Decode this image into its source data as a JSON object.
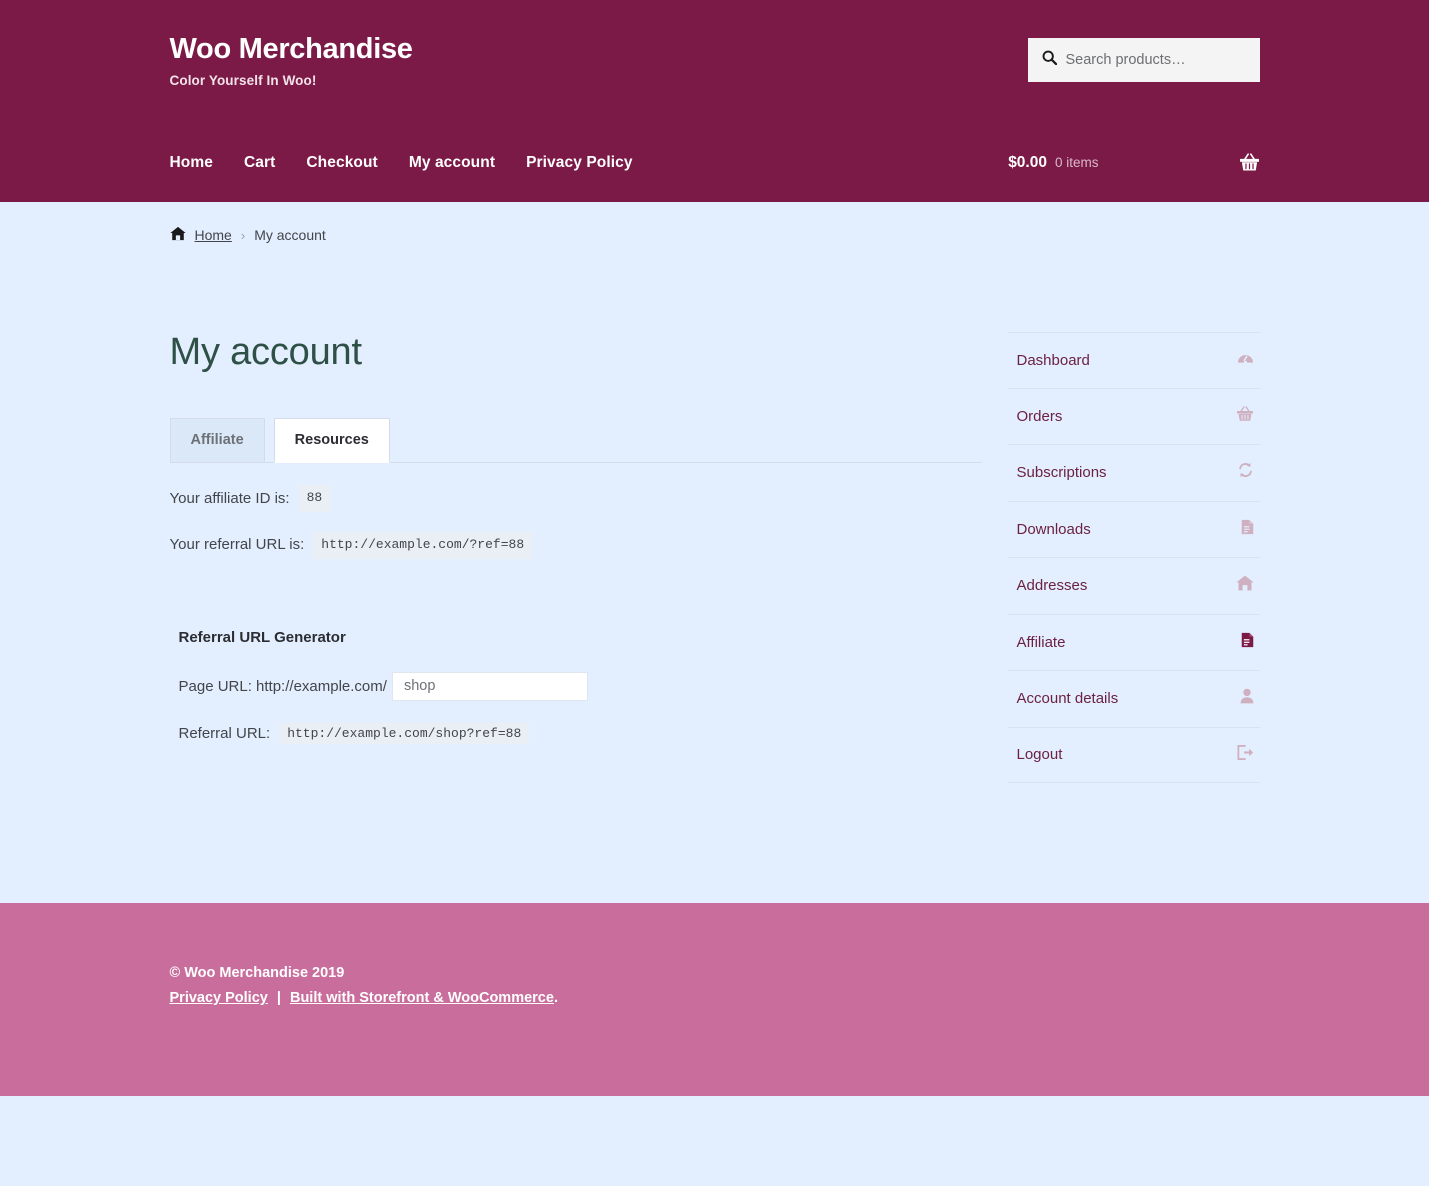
{
  "theme": {
    "header_bg": "#7b1a46",
    "body_bg": "#e3efff",
    "footer_bg": "#c96e9c",
    "heading_color": "#2f5046",
    "link_color": "#6c2142",
    "active_icon_color": "#7b1a46",
    "muted_icon_color": "#c9a8ba"
  },
  "header": {
    "site_title": "Woo Merchandise",
    "site_description": "Color Yourself In Woo!",
    "search": {
      "icon": "search-icon",
      "placeholder": "Search products…",
      "value": ""
    },
    "nav": [
      {
        "label": "Home",
        "name": "nav-home"
      },
      {
        "label": "Cart",
        "name": "nav-cart"
      },
      {
        "label": "Checkout",
        "name": "nav-checkout"
      },
      {
        "label": "My account",
        "name": "nav-my-account"
      },
      {
        "label": "Privacy Policy",
        "name": "nav-privacy-policy"
      }
    ],
    "cart": {
      "amount": "$0.00",
      "count": "0 items",
      "icon": "basket-icon"
    }
  },
  "breadcrumb": {
    "home_icon": "home-icon",
    "home_label": "Home",
    "separator": "›",
    "current": "My account"
  },
  "main": {
    "page_title": "My account",
    "tabs": [
      {
        "label": "Affiliate",
        "active": false
      },
      {
        "label": "Resources",
        "active": true
      }
    ],
    "affiliate_id": {
      "label": "Your affiliate ID is:",
      "value": "88"
    },
    "referral_url": {
      "label": "Your referral URL is:",
      "value": "http://example.com/?ref=88"
    },
    "generator": {
      "heading": "Referral URL Generator",
      "page_url_label": "Page URL: http://example.com/",
      "page_url_value": "shop",
      "page_url_placeholder": "",
      "referral_url_label": "Referral URL:",
      "referral_url_value": "http://example.com/shop?ref=88"
    }
  },
  "sidebar": {
    "items": [
      {
        "label": "Dashboard",
        "icon": "dashboard-icon",
        "active": false
      },
      {
        "label": "Orders",
        "icon": "basket-icon",
        "active": false
      },
      {
        "label": "Subscriptions",
        "icon": "refresh-icon",
        "active": false
      },
      {
        "label": "Downloads",
        "icon": "document-download-icon",
        "active": false
      },
      {
        "label": "Addresses",
        "icon": "home-icon",
        "active": false
      },
      {
        "label": "Affiliate",
        "icon": "file-text-icon",
        "active": true
      },
      {
        "label": "Account details",
        "icon": "user-icon",
        "active": false
      },
      {
        "label": "Logout",
        "icon": "logout-icon",
        "active": false
      }
    ]
  },
  "footer": {
    "copyright": "© Woo Merchandise 2019",
    "privacy_policy": "Privacy Policy",
    "separator": "|",
    "built_with": "Built with Storefront & WooCommerce",
    "trailing": "."
  }
}
